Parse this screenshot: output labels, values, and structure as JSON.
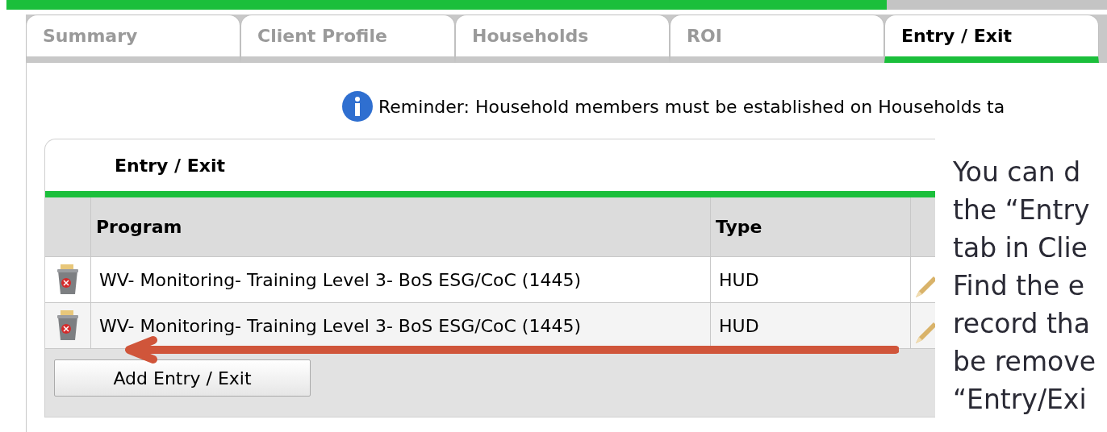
{
  "progress": {
    "level": 0.8
  },
  "tabs": [
    {
      "label": "Summary",
      "selected": false
    },
    {
      "label": "Client Profile",
      "selected": false
    },
    {
      "label": "Households",
      "selected": false
    },
    {
      "label": "ROI",
      "selected": false
    },
    {
      "label": "Entry / Exit",
      "selected": true
    }
  ],
  "reminder": "Reminder: Household members must be established on Households ta",
  "panel": {
    "title": "Entry / Exit",
    "columns": [
      "Program",
      "Type"
    ],
    "rows": [
      {
        "program": "WV- Monitoring- Training Level 3- BoS ESG/CoC (1445)",
        "type": "HUD"
      },
      {
        "program": "WV- Monitoring- Training Level 3- BoS ESG/CoC (1445)",
        "type": "HUD"
      }
    ],
    "add_button": "Add Entry / Exit"
  },
  "callout": [
    "You can d",
    "the “Entry",
    "tab in Clie",
    "Find the e",
    "record tha",
    "be remove",
    "“Entry/Exi"
  ]
}
